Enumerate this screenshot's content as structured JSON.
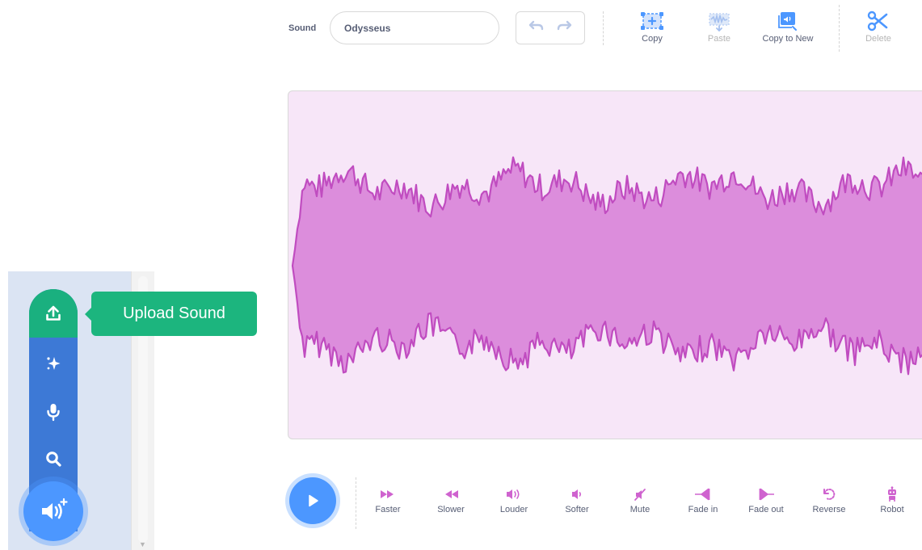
{
  "toolbar": {
    "sound_label": "Sound",
    "sound_name": "Odysseus",
    "undo_icon": "undo-icon",
    "redo_icon": "redo-icon",
    "tools": [
      {
        "label": "Copy",
        "icon": "copy-icon",
        "enabled": true
      },
      {
        "label": "Paste",
        "icon": "paste-icon",
        "enabled": false
      },
      {
        "label": "Copy to New",
        "icon": "copy-to-new-icon",
        "enabled": true
      },
      {
        "label": "Delete",
        "icon": "scissors-icon",
        "enabled": false
      }
    ]
  },
  "add_sound_menu": {
    "items": [
      {
        "name": "upload",
        "icon": "upload-icon"
      },
      {
        "name": "surprise",
        "icon": "sparkle-icon"
      },
      {
        "name": "record",
        "icon": "microphone-icon"
      },
      {
        "name": "choose",
        "icon": "search-icon"
      }
    ],
    "main_icon": "add-sound-icon",
    "tooltip": "Upload Sound"
  },
  "effects": [
    {
      "label": "Faster",
      "icon": "faster-icon"
    },
    {
      "label": "Slower",
      "icon": "slower-icon"
    },
    {
      "label": "Louder",
      "icon": "louder-icon"
    },
    {
      "label": "Softer",
      "icon": "softer-icon"
    },
    {
      "label": "Mute",
      "icon": "mute-icon"
    },
    {
      "label": "Fade in",
      "icon": "fade-in-icon"
    },
    {
      "label": "Fade out",
      "icon": "fade-out-icon"
    },
    {
      "label": "Reverse",
      "icon": "reverse-icon"
    },
    {
      "label": "Robot",
      "icon": "robot-icon"
    }
  ],
  "colors": {
    "accent_blue": "#4c97ff",
    "menu_blue": "#3d79d6",
    "upload_green": "#1ab07f",
    "sound_magenta": "#cf63cf",
    "wave_fill": "#dc8ddc",
    "wave_bg": "#f7e6f8",
    "text_gray": "#575e75"
  }
}
